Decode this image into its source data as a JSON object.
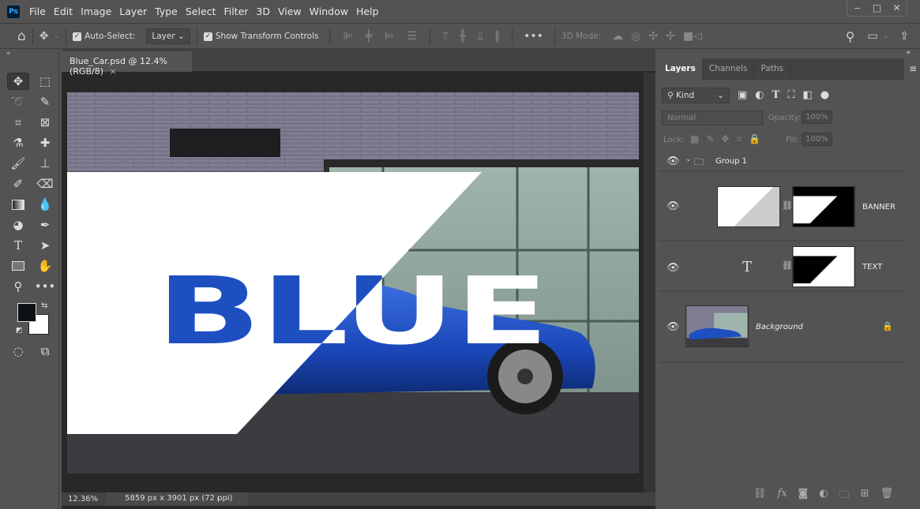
{
  "app": {
    "logo": "Ps"
  },
  "menu": [
    "File",
    "Edit",
    "Image",
    "Layer",
    "Type",
    "Select",
    "Filter",
    "3D",
    "View",
    "Window",
    "Help"
  ],
  "window_controls": {
    "minimize": "‒",
    "maximize": "□",
    "close": "✕"
  },
  "options": {
    "auto_select_label": "Auto-Select:",
    "auto_select_checked": true,
    "auto_select_target": "Layer",
    "show_transform_label": "Show Transform Controls",
    "show_transform_checked": true,
    "more": "•••",
    "mode_3d_label": "3D Mode:"
  },
  "document": {
    "tab_title": "Blue_Car.psd @ 12.4% (RGB/8)",
    "canvas_text": "BLUE"
  },
  "status": {
    "zoom": "12.36%",
    "dimensions": "5859 px x 3901 px (72 ppi)"
  },
  "colors": {
    "foreground": "#0f1214",
    "background": "#ffffff",
    "accent_blue": "#1d4fc0"
  },
  "layers_panel": {
    "tabs": [
      "Layers",
      "Channels",
      "Paths"
    ],
    "filter_kind": "Kind",
    "blend_mode": "Normal",
    "opacity_label": "Opacity:",
    "opacity": "100%",
    "lock_label": "Lock:",
    "fill_label": "Fill:",
    "fill": "100%",
    "layers": [
      {
        "name": "Group 1",
        "type": "group",
        "visible": true
      },
      {
        "name": "BANNER",
        "type": "pixel-with-mask",
        "visible": true
      },
      {
        "name": "TEXT",
        "type": "text-with-mask",
        "visible": true
      },
      {
        "name": "Background",
        "type": "background",
        "visible": true,
        "locked": true
      }
    ]
  }
}
